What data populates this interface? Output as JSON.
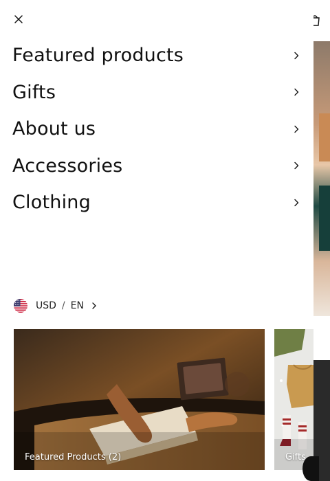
{
  "menu": {
    "items": [
      {
        "label": "Featured products"
      },
      {
        "label": "Gifts"
      },
      {
        "label": "About us"
      },
      {
        "label": "Accessories"
      },
      {
        "label": "Clothing"
      }
    ]
  },
  "locale": {
    "currency": "USD",
    "separator": "/",
    "language": "EN",
    "flag_icon": "us-flag-icon"
  },
  "cards": [
    {
      "caption": "Featured Products (2)"
    },
    {
      "caption": "Gifts"
    }
  ],
  "icons": {
    "close": "close-icon",
    "chevron": "chevron-right-icon",
    "cart": "cart-icon",
    "chat": "chat-icon"
  }
}
